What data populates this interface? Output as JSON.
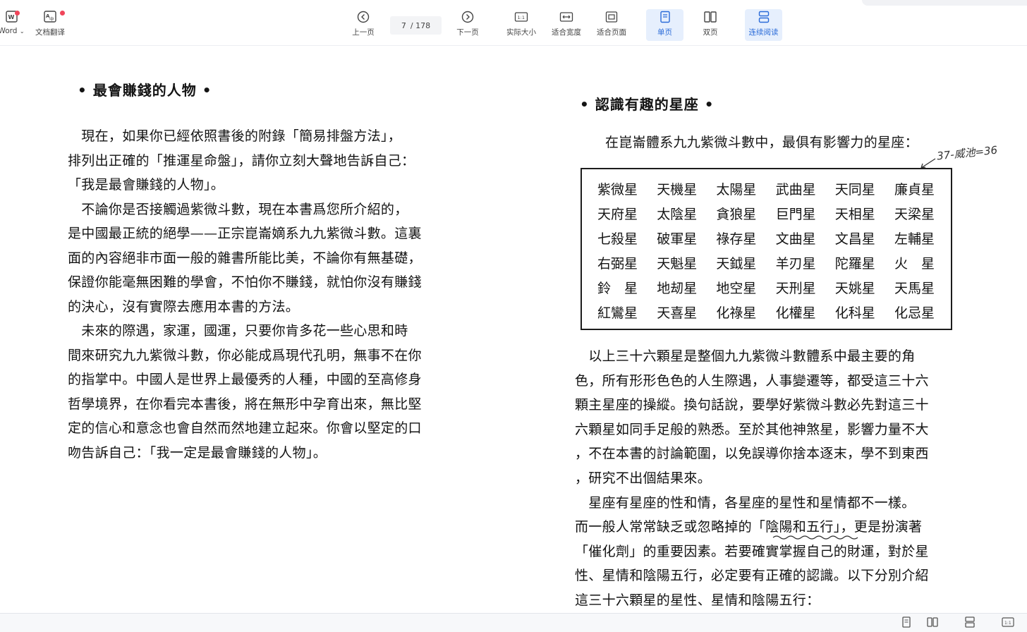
{
  "toolbar": {
    "word_label": "Word",
    "translate_label": "文档翻译",
    "prev_label": "上一页",
    "page_current": "7",
    "page_total": "/ 178",
    "next_label": "下一页",
    "actual_size_label": "实际大小",
    "fit_width_label": "适合宽度",
    "fit_page_label": "适合页面",
    "single_label": "单页",
    "double_label": "双页",
    "continuous_label": "连续阅读",
    "actual_size_glyph": "1:1",
    "accent": "#2a6bd8"
  },
  "left_page": {
    "title": "• 最會賺錢的人物 •",
    "lines": [
      "　現在，如果你已經依照書後的附錄「簡易排盤方法」，",
      "排列出正確的「推運星命盤」，請你立刻大聲地告訴自己：",
      "「我是最會賺錢的人物」。",
      "　不論你是否接觸過紫微斗數，現在本書爲您所介紹的，",
      "是中國最正統的絕學——正宗崑崙嫡系九九紫微斗數。這裏",
      "面的內容絕非市面一般的雜書所能比美，不論你有無基礎，",
      "保證你能毫無困難的學會，不怕你不賺錢，就怕你沒有賺錢",
      "的決心，沒有實際去應用本書的方法。",
      "　未來的際遇，家運，國運，只要你肯多花一些心思和時",
      "間來研究九九紫微斗數，你必能成爲現代孔明，無事不在你",
      "的指掌中。中國人是世界上最優秀的人種，中國的至高修身",
      "哲學境界，在你看完本書後，將在無形中孕育出來，無比堅",
      "定的信心和意念也會自然而然地建立起來。你會以堅定的口",
      "吻告訴自己：「我一定是最會賺錢的人物」。"
    ]
  },
  "right_page": {
    "title": "• 認識有趣的星座 •",
    "intro": "在崑崙體系九九紫微斗數中，最俱有影響力的星座：",
    "handnote": "37-威池=36",
    "stars": [
      [
        "紫微星",
        "天機星",
        "太陽星",
        "武曲星",
        "天同星",
        "廉貞星"
      ],
      [
        "天府星",
        "太陰星",
        "貪狼星",
        "巨門星",
        "天相星",
        "天梁星"
      ],
      [
        "七殺星",
        "破軍星",
        "祿存星",
        "文曲星",
        "文昌星",
        "左輔星"
      ],
      [
        "右弼星",
        "天魁星",
        "天鉞星",
        "羊刃星",
        "陀羅星",
        "火　星"
      ],
      [
        "鈴　星",
        "地刼星",
        "地空星",
        "天刑星",
        "天姚星",
        "天馬星"
      ],
      [
        "紅鸞星",
        "天喜星",
        "化祿星",
        "化權星",
        "化科星",
        "化忌星"
      ]
    ],
    "lines": [
      "　以上三十六顆星是整個九九紫微斗數體系中最主要的角",
      "色，所有形形色色的人生際遇，人事變遷等，都受這三十六",
      "顆主星座的操縱。換句話說，要學好紫微斗數必先對這三十",
      "六顆星如同手足般的熟悉。至於其他神煞星，影響力量不大",
      "，不在本書的討論範圍，以免誤導你捨本逐末，學不到東西",
      "，研究不出個結果來。",
      "　星座有星座的性和情，各星座的星性和星情都不一樣。",
      "而一般人常常缺乏或忽略掉的「陰陽和五行」，更是扮演著",
      "「催化劑」的重要因素。若要確實掌握自己的財運，對於星",
      "性、星情和陰陽五行，必定要有正確的認識。以下分別介紹",
      "這三十六顆星的星性、星情和陰陽五行："
    ]
  },
  "bottom_bar": {
    "actual_size_glyph": "1:1"
  }
}
